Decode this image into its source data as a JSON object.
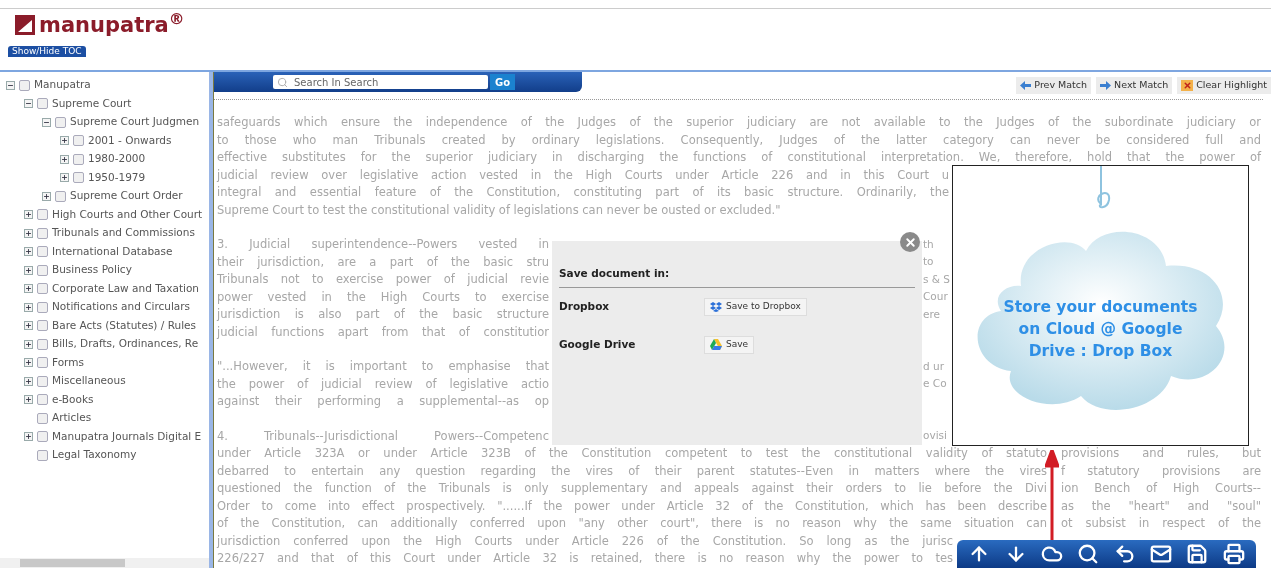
{
  "logo": {
    "text": "manupatra$^{®}$"
  },
  "toc_button": "Show/Hide TOC",
  "tree": [
    {
      "label": "Manupatra",
      "kind": "folder",
      "expanded": true,
      "checked": false,
      "children": [
        {
          "label": "Supreme Court",
          "kind": "folder",
          "expanded": true,
          "checked": false,
          "children": [
            {
              "label": "Supreme Court Judgmen",
              "kind": "folder",
              "expanded": true,
              "checked": false,
              "children": [
                {
                  "label": "2001 - Onwards",
                  "kind": "folder",
                  "expanded": false,
                  "checked": false
                },
                {
                  "label": "1980-2000",
                  "kind": "folder",
                  "expanded": false,
                  "checked": false
                },
                {
                  "label": "1950-1979",
                  "kind": "folder",
                  "expanded": false,
                  "checked": false
                }
              ]
            },
            {
              "label": "Supreme Court Order",
              "kind": "folder",
              "expanded": false,
              "checked": false
            }
          ]
        },
        {
          "label": "High Courts and Other Court",
          "kind": "folder",
          "expanded": false,
          "checked": false
        },
        {
          "label": "Tribunals and Commissions",
          "kind": "folder",
          "expanded": false,
          "checked": false
        },
        {
          "label": "International Database",
          "kind": "folder",
          "expanded": false,
          "checked": false
        },
        {
          "label": "Business Policy",
          "kind": "folder",
          "expanded": false,
          "checked": false
        },
        {
          "label": "Corporate Law and Taxation",
          "kind": "folder",
          "expanded": false,
          "checked": false
        },
        {
          "label": "Notifications and Circulars",
          "kind": "folder",
          "expanded": false,
          "checked": false
        },
        {
          "label": "Bare Acts (Statutes) / Rules",
          "kind": "folder",
          "expanded": false,
          "checked": false
        },
        {
          "label": "Bills, Drafts, Ordinances, Re",
          "kind": "folder",
          "expanded": false,
          "checked": false
        },
        {
          "label": "Forms",
          "kind": "folder",
          "expanded": false,
          "checked": false
        },
        {
          "label": "Miscellaneous",
          "kind": "folder",
          "expanded": false,
          "checked": false
        },
        {
          "label": "e-Books",
          "kind": "folder",
          "expanded": false,
          "checked": false
        },
        {
          "label": "Articles",
          "kind": "leaf",
          "checked": false
        },
        {
          "label": "Manupatra Journals Digital E",
          "kind": "folder",
          "expanded": false,
          "checked": false
        },
        {
          "label": "Legal Taxonomy",
          "kind": "leaf",
          "checked": false
        }
      ]
    }
  ],
  "search": {
    "placeholder": "Search In Search",
    "button": "Go"
  },
  "match_buttons": [
    {
      "label": "Prev Match",
      "kind": "prev"
    },
    {
      "label": "Next Match",
      "kind": "next"
    },
    {
      "label": "Clear Highlight",
      "kind": "clear"
    }
  ],
  "paragraphs": [
    [
      {
        "kind": "full",
        "segments": [
          "safeguards which ensure the independence of the Judges of the superior judiciary are not available to the Judges of the subordinate judiciary or"
        ]
      },
      {
        "kind": "full",
        "segments": [
          "to those who man Tribunals created by ordinary legislations. Consequently, Judges of the latter category can never be considered full and"
        ]
      },
      {
        "kind": "full",
        "segments": [
          "effective substitutes for the superior judiciary in discharging the functions of constitutional interpretation. We, therefore, hold that the power of"
        ]
      },
      {
        "kind": "cloud",
        "segments": [
          "judicial review over legislative action vested in the High Courts under Article 226 and in this Court u"
        ]
      },
      {
        "kind": "cloud",
        "segments": [
          "integral and essential feature of the Constitution, constituting part of its basic structure. Ordinarily, the"
        ]
      },
      {
        "kind": "last",
        "segments": [
          "Supreme Court to test the constitutional validity of legislations can never be ousted or excluded.\""
        ]
      }
    ],
    [
      {
        "kind": "dialog",
        "segments": [
          "3. Judicial superintendence--Powers vested in",
          "th"
        ]
      },
      {
        "kind": "dialog",
        "segments": [
          "their jurisdiction, are a part of the basic stru",
          "to"
        ]
      },
      {
        "kind": "dialog",
        "segments": [
          "Tribunals not to exercise power of judicial revie",
          "s & S"
        ]
      },
      {
        "kind": "dialog",
        "segments": [
          "power vested in the High Courts to exercise",
          "Cour"
        ]
      },
      {
        "kind": "dialog",
        "segments": [
          "jurisdiction is also part of the basic structure",
          "ere"
        ]
      },
      {
        "kind": "dialog",
        "segments": [
          "judicial functions apart from that of constitutior"
        ]
      }
    ],
    [
      {
        "kind": "dialog",
        "segments": [
          "\"...However, it is important to emphasise that",
          "d ur"
        ]
      },
      {
        "kind": "dialog",
        "segments": [
          "the power of judicial review of legislative actio",
          "e Co"
        ]
      },
      {
        "kind": "dialog",
        "segments": [
          "against their performing a supplemental--as op"
        ]
      }
    ],
    [
      {
        "kind": "dialog",
        "segments": [
          "4. Tribunals--Jurisdictional Powers--Competenc",
          "ovisi"
        ]
      },
      {
        "kind": "arrow",
        "segments": [
          "under Article 323A or under Article 323B of the Constitution competent to test the constitutional validity of statuto",
          "provisions and rules, but"
        ]
      },
      {
        "kind": "arrow",
        "segments": [
          "debarred to entertain any question regarding the vires of their parent statutes--Even in matters where the vires",
          "f statutory provisions are"
        ]
      },
      {
        "kind": "arrow",
        "segments": [
          "questioned the function of the Tribunals is only supplementary and appeals against their orders to lie before the Divi",
          "ion Bench of High Courts--"
        ]
      },
      {
        "kind": "arrow",
        "segments": [
          "Order to come into effect prospectively. \"......If the power under Article 32 of the Constitution, which has been describe",
          "as the \"heart\" and \"soul\""
        ]
      },
      {
        "kind": "arrow",
        "segments": [
          "of the Constitution, can additionally conferred upon \"any other court\", there is no reason why the same situation can",
          "ot subsist in respect of the"
        ]
      },
      {
        "kind": "toolbar",
        "segments": [
          "jurisdiction conferred upon the High Courts under Article 226 of the Constitution. So long as the jurisc"
        ]
      },
      {
        "kind": "toolbar",
        "segments": [
          "226/227 and that of this Court under Article 32 is retained, there is no reason why the power to tes"
        ]
      }
    ]
  ],
  "save_dialog": {
    "title": "Save document in:",
    "rows": [
      {
        "label": "Dropbox",
        "button": "Save to Dropbox",
        "kind": "dropbox"
      },
      {
        "label": "Google Drive",
        "button": "Save",
        "kind": "drive"
      }
    ]
  },
  "cloud_promo": {
    "text": "Store your documents\non Cloud @ Google\nDrive : Drop Box"
  },
  "toolbar": [
    {
      "kind": "up"
    },
    {
      "kind": "down"
    },
    {
      "kind": "cloud"
    },
    {
      "kind": "search"
    },
    {
      "kind": "undo"
    },
    {
      "kind": "mail"
    },
    {
      "kind": "save"
    },
    {
      "kind": "print"
    }
  ]
}
